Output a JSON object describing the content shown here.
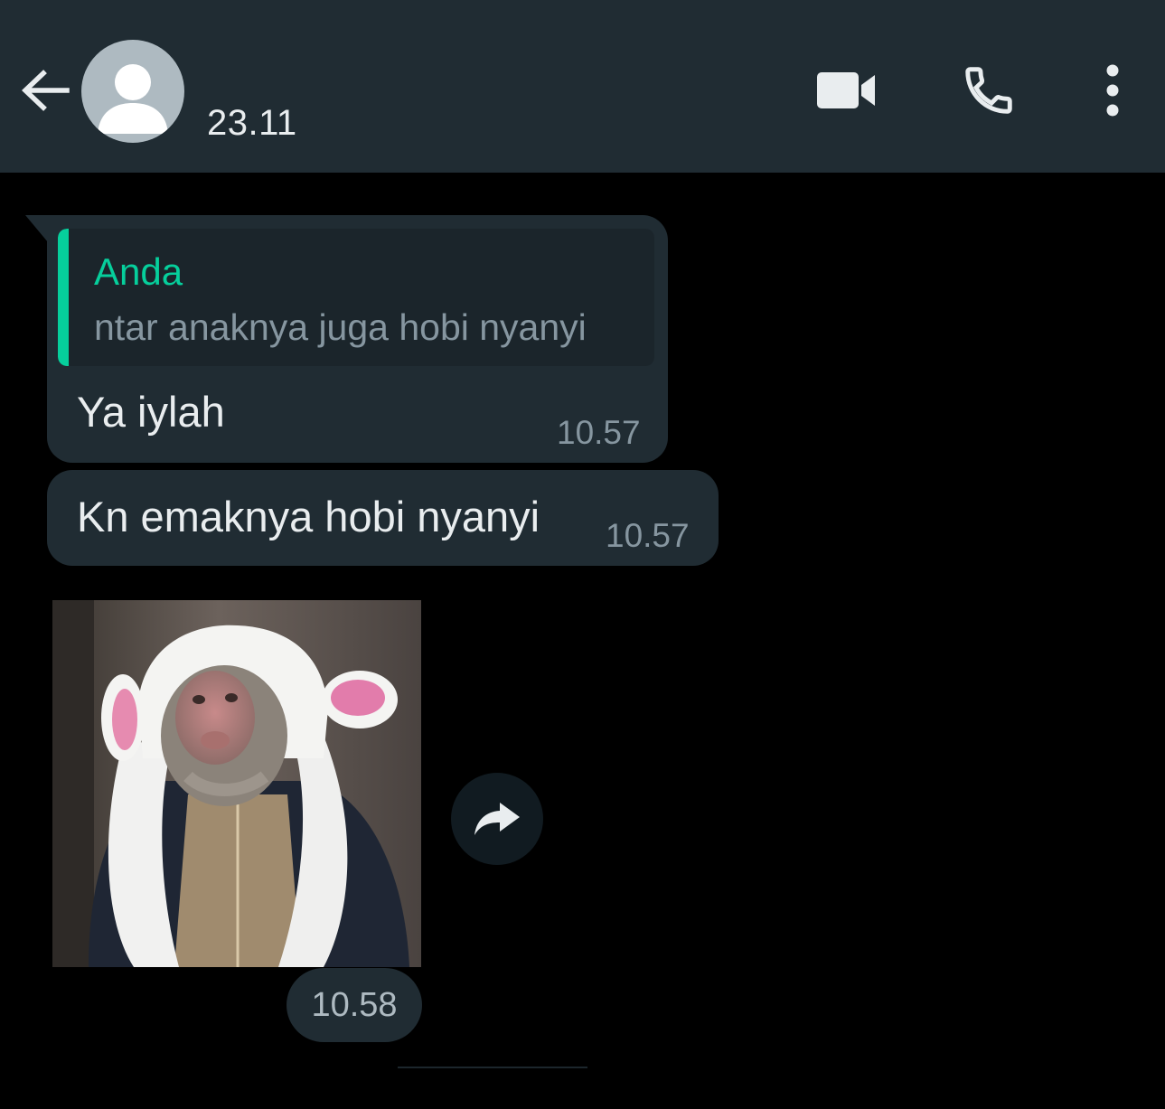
{
  "header": {
    "contact_name": "23.11",
    "icons": {
      "back": "arrow-left-icon",
      "avatar": "default-user-avatar-icon",
      "video": "video-camera-icon",
      "call": "phone-icon",
      "menu": "more-vertical-icon"
    }
  },
  "messages": [
    {
      "quoted_author": "Anda",
      "quoted_text": "ntar anaknya juga hobi nyanyi",
      "text": "Ya iylah",
      "time": "10.57"
    },
    {
      "text": "Kn emaknya hobi nyanyi",
      "time": "10.57"
    },
    {
      "type": "sticker",
      "sticker_icon": "monkey-in-bunny-hood-sticker",
      "forward_icon": "forward-arrow-icon",
      "time": "10.58"
    }
  ],
  "colors": {
    "header_bg": "#202c33",
    "chat_bg": "#000000",
    "bubble_bg": "#202c33",
    "accent": "#06cf9c",
    "text_primary": "#e9edef",
    "text_secondary": "#8696a0"
  }
}
